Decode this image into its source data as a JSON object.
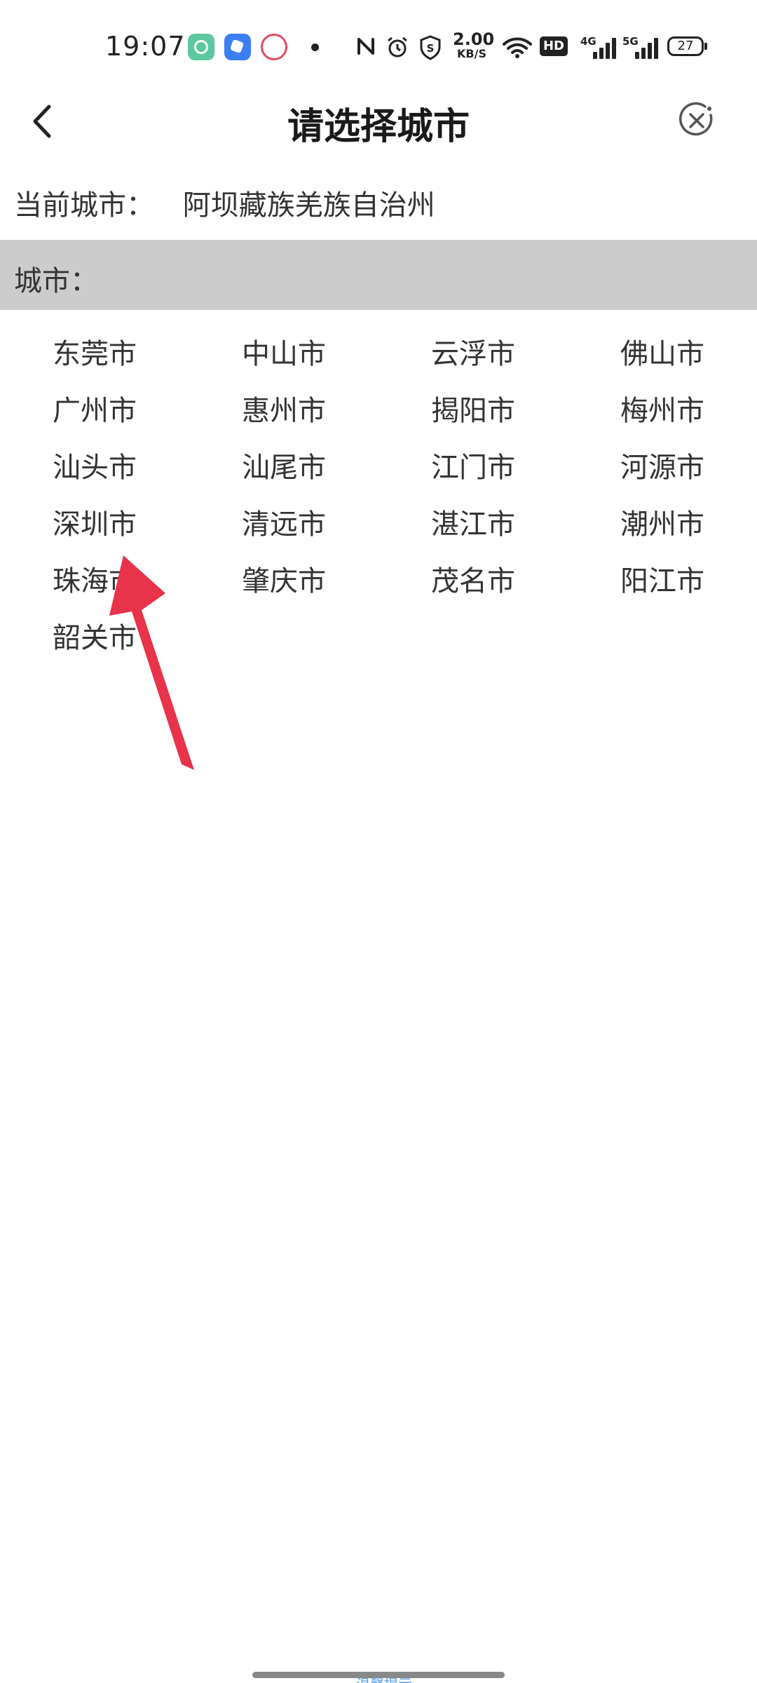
{
  "status_bar": {
    "time": "19:07",
    "net_speed_value": "2.00",
    "net_speed_unit": "KB/S",
    "hd_label": "HD",
    "sim1_label": "4G",
    "sim2_label": "5G",
    "battery": "27"
  },
  "header": {
    "title": "请选择城市",
    "back_icon": "chevron-left-icon",
    "close_icon": "close-circle-icon"
  },
  "current_city": {
    "label": "当前城市：",
    "value": "阿坝藏族羌族自治州"
  },
  "city_section": {
    "label": "城市："
  },
  "cities": [
    "东莞市",
    "中山市",
    "云浮市",
    "佛山市",
    "广州市",
    "惠州市",
    "揭阳市",
    "梅州市",
    "汕头市",
    "汕尾市",
    "江门市",
    "河源市",
    "深圳市",
    "清远市",
    "湛江市",
    "潮州市",
    "珠海市",
    "肇庆市",
    "茂名市",
    "阳江市",
    "韶关市"
  ],
  "bottom_hint": "温馨提示",
  "colors": {
    "section_bg": "#cccccc",
    "annotation_arrow": "#e8334a",
    "title": "#1a1a1a"
  }
}
